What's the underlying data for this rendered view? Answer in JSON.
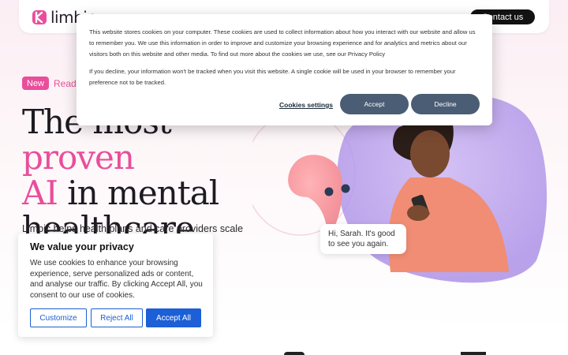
{
  "brand": {
    "name": "limbic",
    "accent": "#e94e9b"
  },
  "nav": {
    "contact_label": "Contact us"
  },
  "hero": {
    "badge": "New",
    "link_text": "Read",
    "headline_line1_a": "The most ",
    "headline_line1_b": "proven",
    "headline_line2_a": "AI",
    "headline_line2_b": " in mental",
    "headline_line3": "healthcare",
    "subheadline": "Limbic helps health plans and care providers scale",
    "chat_line1": "Hi, Sarah. It's good",
    "chat_line2": "to see you again."
  },
  "cookie_banner": {
    "paragraph1": "This website stores cookies on your computer. These cookies are used to collect information about how you interact with our website and allow us to remember you. We use this information in order to improve and customize your browsing experience and for analytics and metrics about our visitors both on this website and other media. To find out more about the cookies we use, see our Privacy Policy",
    "paragraph2": "If you decline, your information won't be tracked when you visit this website. A single cookie will be used in your browser to remember your preference not to be tracked.",
    "settings_label": "Cookies settings",
    "accept_label": "Accept",
    "decline_label": "Decline"
  },
  "privacy_box": {
    "title": "We value your privacy",
    "text": "We use cookies to enhance your browsing experience, serve personalized ads or content, and analyse our traffic. By clicking Accept All, you consent to our use of cookies.",
    "customize_label": "Customize",
    "reject_label": "Reject All",
    "accept_all_label": "Accept All"
  }
}
